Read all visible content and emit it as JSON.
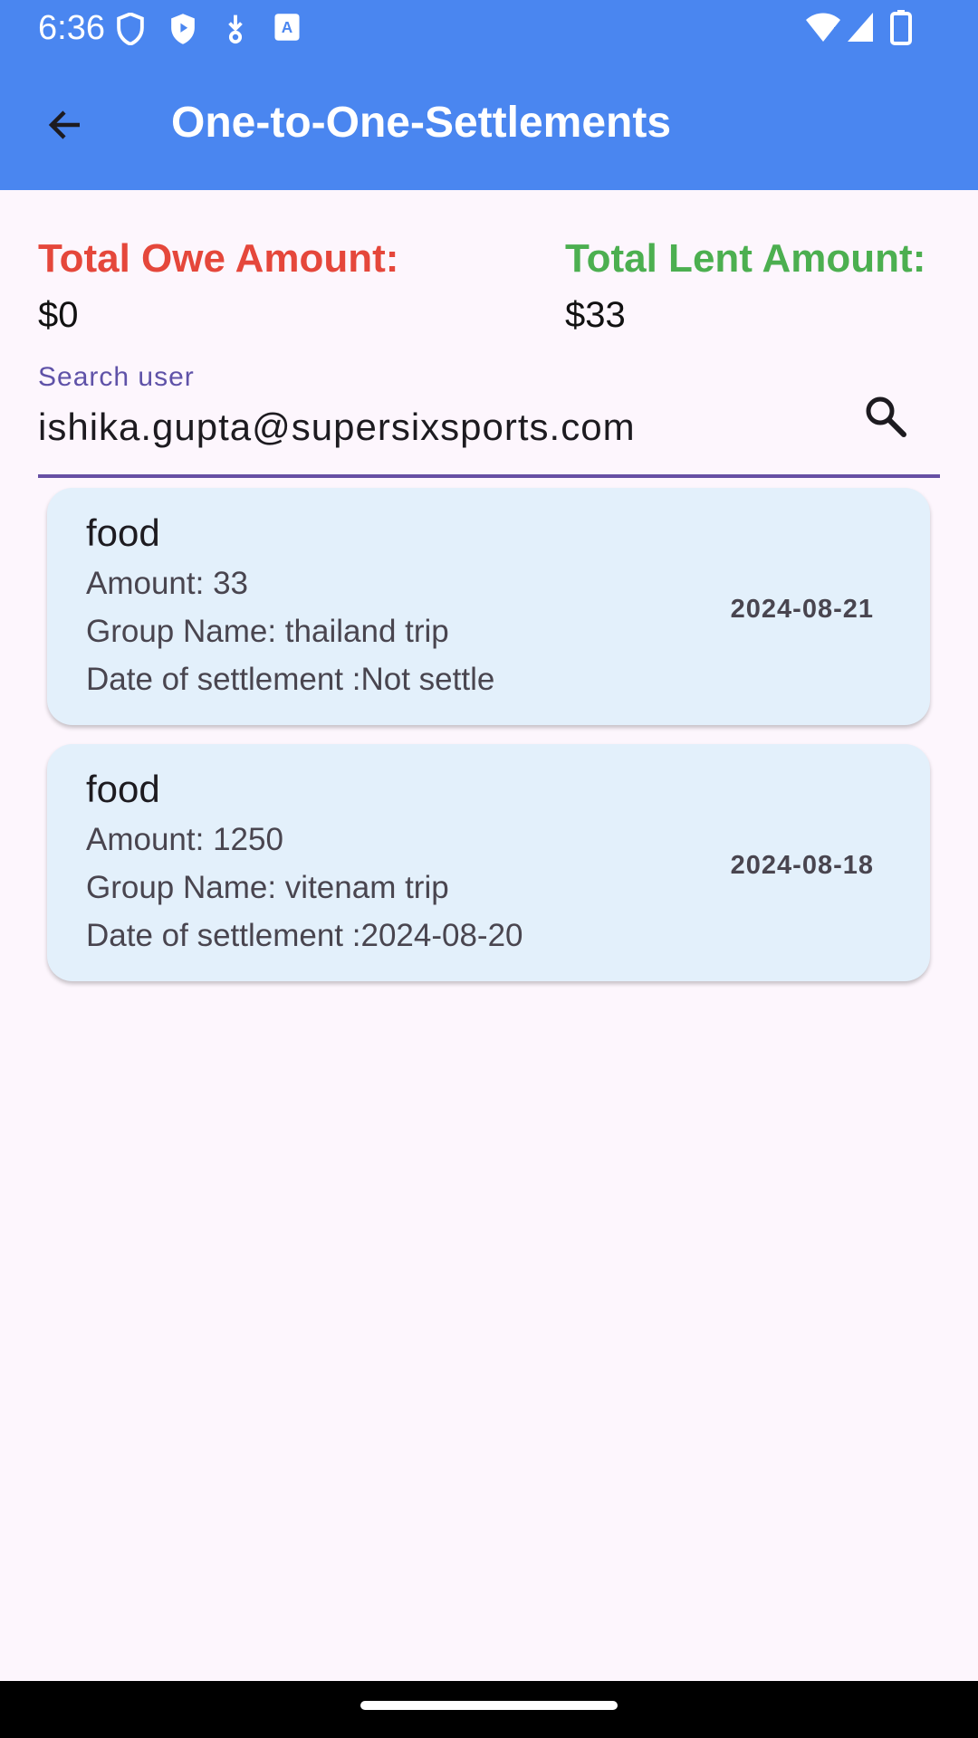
{
  "status_bar": {
    "time": "6:36",
    "left_icons": [
      "shield-outline-icon",
      "shield-play-icon",
      "download-dot-icon",
      "font-download-icon"
    ],
    "right_icons": [
      "wifi-icon",
      "signal-icon",
      "battery-icon"
    ]
  },
  "app_bar": {
    "title": "One-to-One-Settlements",
    "back_icon": "arrow-back-icon",
    "color": "#4A86F0"
  },
  "totals": {
    "owe_label": "Total Owe Amount:",
    "owe_value": "$0",
    "owe_color": "#E5473B",
    "lent_label": "Total Lent Amount:",
    "lent_value": "$33",
    "lent_color": "#4CAF50"
  },
  "search": {
    "label": "Search user",
    "value": "ishika.gupta@supersixsports.com",
    "icon": "search-icon"
  },
  "settlements": [
    {
      "title": "food",
      "amount": "Amount: 33",
      "group": "Group Name: thailand trip",
      "settlement_date": "Date of settlement :Not settle",
      "date": "2024-08-21"
    },
    {
      "title": "food",
      "amount": "Amount: 1250",
      "group": "Group Name: vitenam trip",
      "settlement_date": "Date of settlement :2024-08-20",
      "date": "2024-08-18"
    }
  ]
}
